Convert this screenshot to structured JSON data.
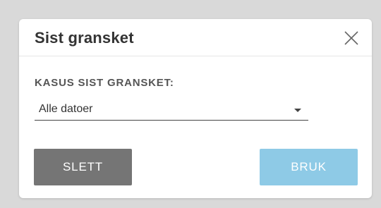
{
  "dialog": {
    "title": "Sist gransket",
    "close_icon": "close-icon",
    "field_label": "KASUS SIST GRANSKET:",
    "select": {
      "selected": "Alle datoer",
      "icon": "caret-down-icon"
    },
    "buttons": {
      "delete_label": "SLETT",
      "apply_label": "BRUK"
    }
  },
  "colors": {
    "delete_button": "#757575",
    "apply_button": "#8ecae6",
    "backdrop": "#d9d9d9"
  }
}
